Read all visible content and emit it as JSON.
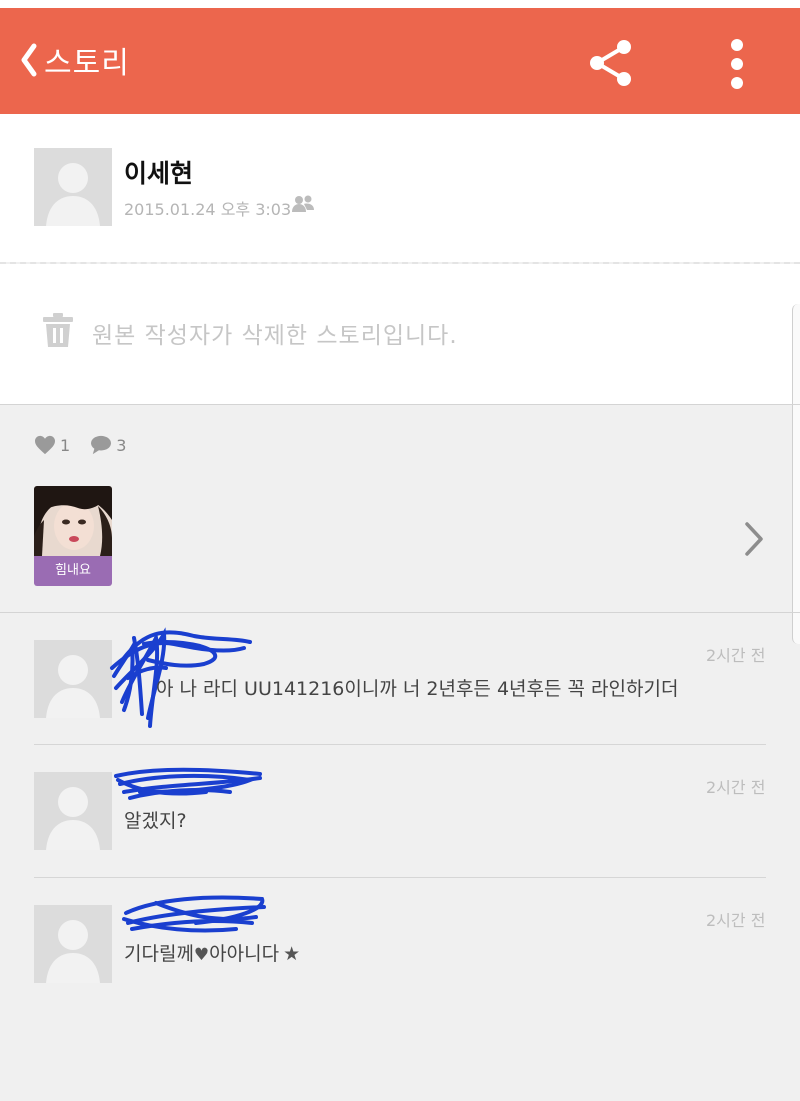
{
  "header": {
    "back_label": "스토리",
    "bar_color": "#ec664d",
    "share_icon": "share-icon",
    "more_icon": "more-vertical-icon"
  },
  "post": {
    "author_name": "이세현",
    "date": "2015.01.24 오후 3:03",
    "privacy_icon": "friends-icon",
    "deleted_message": "원본 작성자가 삭제한 스토리입니다."
  },
  "stats": {
    "likes": "1",
    "comments": "3"
  },
  "sticker": {
    "label": "힘내요",
    "label_color": "#9a6cb3"
  },
  "comments": [
    {
      "author": "",
      "time": "2시간 전",
      "text": "아 나 라디 UU141216이니까 너 2년후든 4년후든 꼭 라인하기더"
    },
    {
      "author": "",
      "time": "2시간 전",
      "text": "알겠지?"
    },
    {
      "author": "",
      "time": "2시간 전",
      "text_before": "기다릴께",
      "text_after": "아아니다"
    }
  ],
  "redaction_color": "#1a3fcf"
}
